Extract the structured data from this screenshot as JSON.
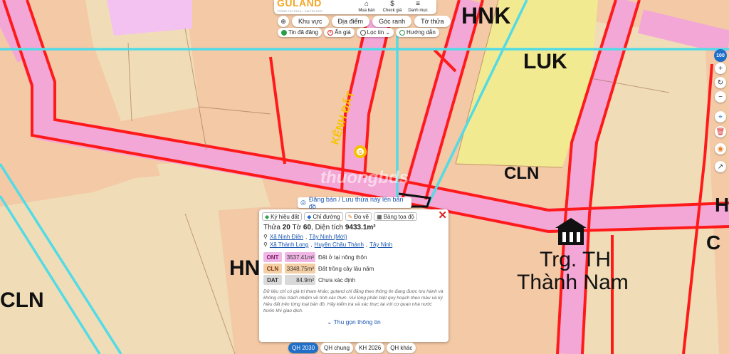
{
  "logo": {
    "name": "GULAND",
    "tagline": "THÔNG TIN THỬA – GIÁ TRỊ THẬT"
  },
  "toolbar": {
    "items": [
      {
        "label": "Mua bán",
        "icon": "house-icon"
      },
      {
        "label": "Check giá",
        "icon": "dollar-icon"
      },
      {
        "label": "Danh mục",
        "icon": "menu-icon"
      }
    ]
  },
  "search_tabs": {
    "target_icon": "⊕",
    "items": [
      "Khu vực",
      "Địa điểm",
      "Góc ranh",
      "Tờ thửa"
    ]
  },
  "filters": [
    "Tin đã đăng",
    "Ẩn giá",
    "Lọc tin",
    "Hướng dẫn"
  ],
  "zoom_level": "100",
  "map_labels": {
    "hnk": "HNK",
    "luk": "LUK",
    "cln_right": "CLN",
    "hn_center": "HN",
    "cln_left": "CLN",
    "school_line1": "Trg. TH",
    "school_line2": "Thành Nam",
    "road_name": "KÊNH ĐẤT",
    "h_right": "H",
    "c_right": "C",
    "watermark": "thuongbds"
  },
  "save_bar": {
    "label": "Đăng bán / Lưu thửa này lên bản đồ"
  },
  "panel": {
    "tabs": [
      "Ký hiệu đất",
      "Chỉ đường",
      "Đo vẽ",
      "Bảng tọa độ"
    ],
    "parcel_label_pre": "Thửa ",
    "parcel_no": "20",
    "parcel_mid": " Tờ ",
    "sheet_no": "60",
    "area_label": ", Diện tích ",
    "area_value": "9433.1m²",
    "address_new": {
      "commune": "Xã Ninh Điền",
      "province": "Tây Ninh (Mới)"
    },
    "address_old": {
      "commune": "Xã Thành Long",
      "district": "Huyện Châu Thành",
      "province": "Tây Ninh"
    },
    "land_uses": [
      {
        "code": "ONT",
        "area": "3537.41m²",
        "desc": "Đất ở tại nông thôn",
        "color": "#f0b6e6"
      },
      {
        "code": "CLN",
        "area": "3348.75m²",
        "desc": "Đất trồng cây lâu năm",
        "color": "#f4cfa5"
      },
      {
        "code": "DAT",
        "area": "84.9m²",
        "desc": "Chưa xác định",
        "color": "#d9d9d9"
      }
    ],
    "disclaimer": "Dữ liệu chỉ có giá trị tham khảo; guland chỉ đăng theo thông tin đang được lưu hành và không chịu trách nhiệm về tính xác thực. Vui lòng phân biệt quy hoạch theo màu và ký hiệu đất trên từng loại bản đồ. Hãy kiểm tra và xác thực lại với cơ quan nhà nước trước khi giao dịch.",
    "collapse": "Thu gọn thông tin"
  },
  "bottom_tabs": [
    "QH 2030",
    "QH chung",
    "KH 2026",
    "QH khác"
  ],
  "colors": {
    "cln_land": "#f3c9a6",
    "hnk_land": "#f0ddb7",
    "luk_land": "#f2ea91",
    "road_pink": "#f3a7d6",
    "road_red": "#ff1a1a",
    "water_cyan": "#53dbe5",
    "accent_blue": "#1f6fc8",
    "logo_orange": "#f5a623"
  }
}
